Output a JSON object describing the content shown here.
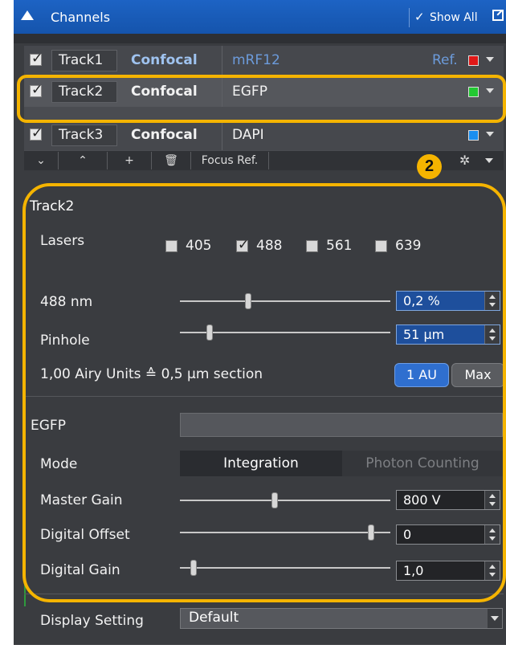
{
  "header": {
    "title": "Channels",
    "show_all": "Show All"
  },
  "tracks": [
    {
      "name": "Track1",
      "method": "Confocal",
      "dye": "mRF12",
      "ref": "Ref.",
      "color": "#e01818"
    },
    {
      "name": "Track2",
      "method": "Confocal",
      "dye": "EGFP",
      "color": "#22c832"
    },
    {
      "name": "Track3",
      "method": "Confocal",
      "dye": "DAPI",
      "color": "#1a8ef0"
    }
  ],
  "toolbar": {
    "focus_ref": "Focus Ref."
  },
  "callout": "2",
  "track_section": {
    "title": "Track2",
    "lasers_label": "Lasers",
    "lasers": [
      {
        "value": "405",
        "checked": false
      },
      {
        "value": "488",
        "checked": true
      },
      {
        "value": "561",
        "checked": false
      },
      {
        "value": "639",
        "checked": false
      }
    ],
    "laser_power": {
      "label": "488 nm",
      "value": "0,2 %",
      "level": 0.32
    },
    "pinhole": {
      "label": "Pinhole",
      "value": "51 µm",
      "level": 0.13
    },
    "airy_text": "1,00 Airy Units ≙ 0,5 µm section",
    "btn_1au": "1 AU",
    "btn_max": "Max"
  },
  "detector": {
    "name": "EGFP",
    "mode_label": "Mode",
    "mode_on": "Integration",
    "mode_off": "Photon Counting",
    "master_gain": {
      "label": "Master Gain",
      "value": "800 V",
      "level": 0.45
    },
    "digital_offset": {
      "label": "Digital Offset",
      "value": "0",
      "level": 0.92
    },
    "digital_gain": {
      "label": "Digital Gain",
      "value": "1,0",
      "level": 0.05
    }
  },
  "display_setting": {
    "label": "Display Setting",
    "value": "Default"
  },
  "accent_color": "#f5b400"
}
